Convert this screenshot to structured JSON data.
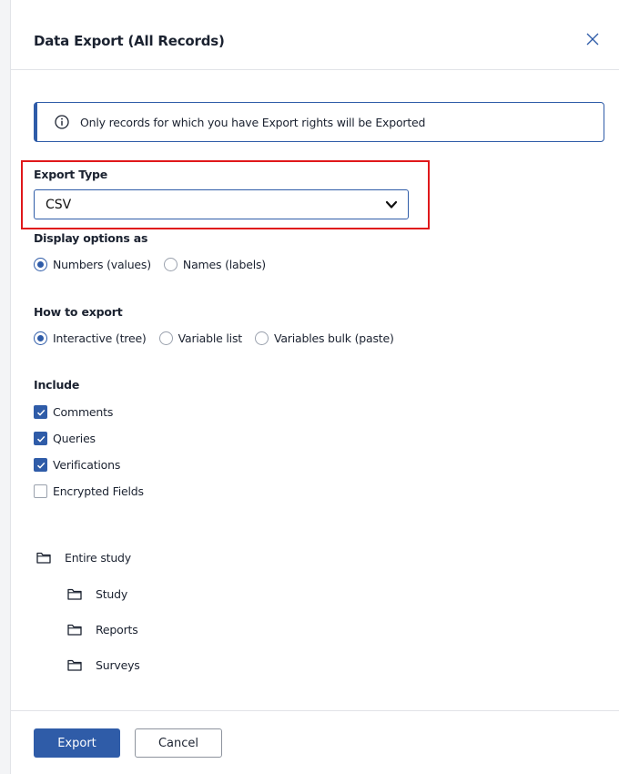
{
  "modal": {
    "title": "Data Export (All Records)"
  },
  "info": {
    "text": "Only records for which you have Export rights will be Exported"
  },
  "export_type": {
    "label": "Export Type",
    "selected": "CSV"
  },
  "display_options": {
    "label": "Display options as",
    "options": [
      {
        "label": "Numbers (values)",
        "checked": true
      },
      {
        "label": "Names (labels)",
        "checked": false
      }
    ]
  },
  "how_to_export": {
    "label": "How to export",
    "options": [
      {
        "label": "Interactive (tree)",
        "checked": true
      },
      {
        "label": "Variable list",
        "checked": false
      },
      {
        "label": "Variables bulk (paste)",
        "checked": false
      }
    ]
  },
  "include": {
    "label": "Include",
    "items": [
      {
        "label": "Comments",
        "checked": true
      },
      {
        "label": "Queries",
        "checked": true
      },
      {
        "label": "Verifications",
        "checked": true
      },
      {
        "label": "Encrypted Fields",
        "checked": false
      }
    ]
  },
  "tree": {
    "root": "Entire study",
    "children": [
      "Study",
      "Reports",
      "Surveys"
    ]
  },
  "footer": {
    "export_label": "Export",
    "cancel_label": "Cancel"
  },
  "colors": {
    "accent": "#2f5ca8",
    "highlight": "#e0181b"
  }
}
